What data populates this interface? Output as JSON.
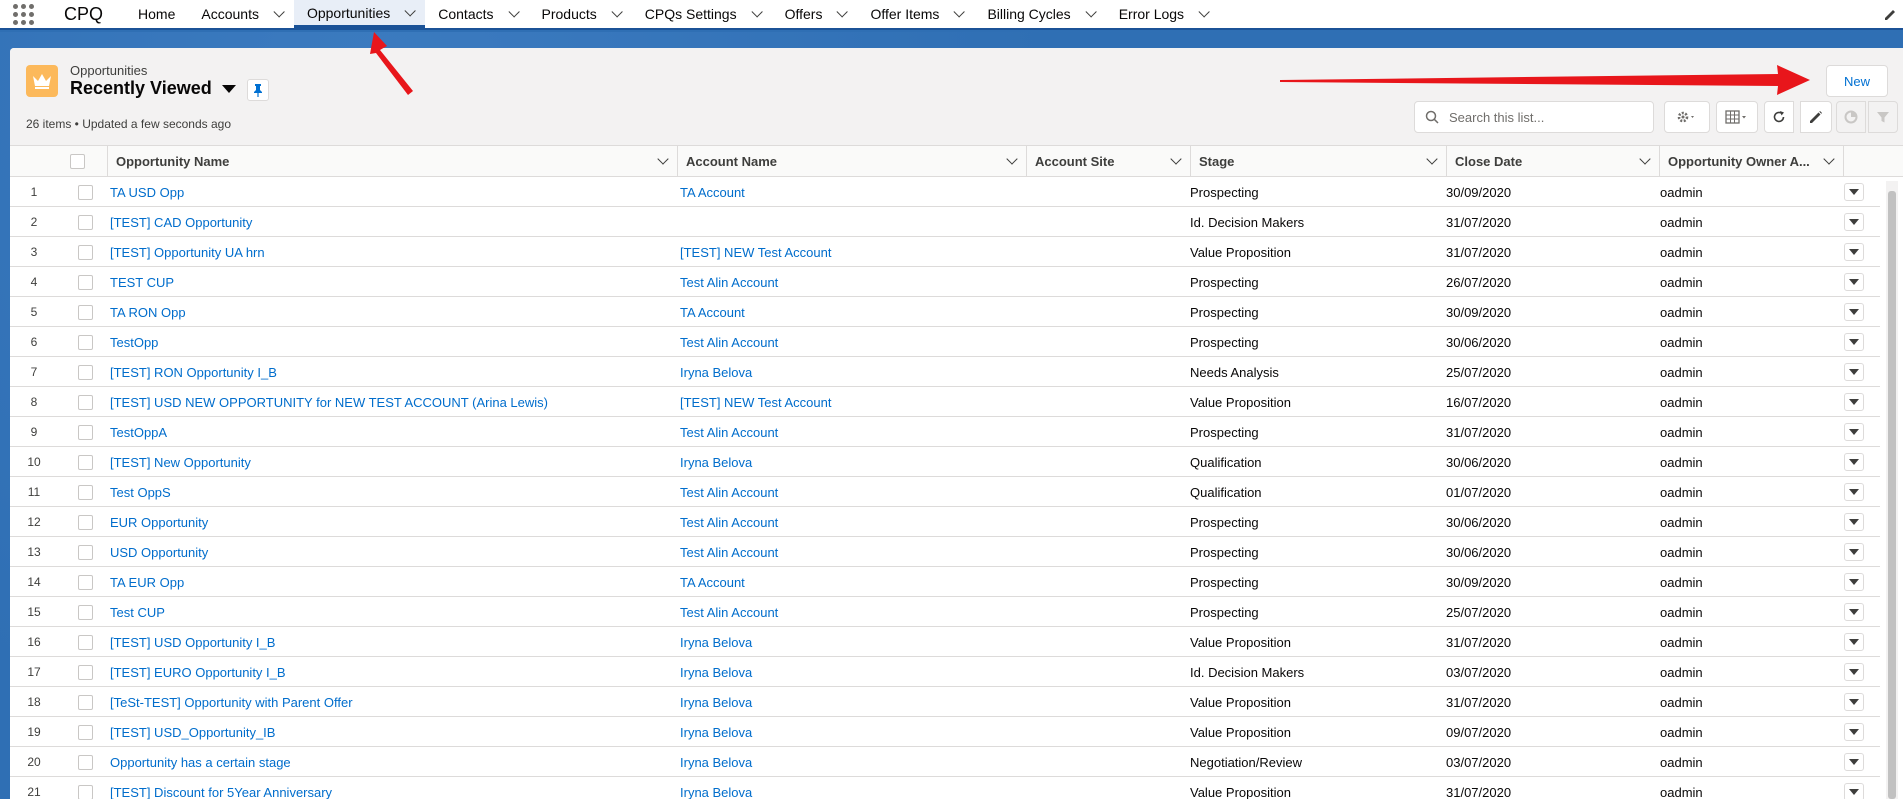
{
  "nav": {
    "app_name": "CPQ",
    "items": [
      {
        "label": "Home",
        "has_menu": false,
        "active": false
      },
      {
        "label": "Accounts",
        "has_menu": true,
        "active": false
      },
      {
        "label": "Opportunities",
        "has_menu": true,
        "active": true
      },
      {
        "label": "Contacts",
        "has_menu": true,
        "active": false
      },
      {
        "label": "Products",
        "has_menu": true,
        "active": false
      },
      {
        "label": "CPQs Settings",
        "has_menu": true,
        "active": false
      },
      {
        "label": "Offers",
        "has_menu": true,
        "active": false
      },
      {
        "label": "Offer Items",
        "has_menu": true,
        "active": false
      },
      {
        "label": "Billing Cycles",
        "has_menu": true,
        "active": false
      },
      {
        "label": "Error Logs",
        "has_menu": true,
        "active": false
      }
    ]
  },
  "header": {
    "object_label": "Opportunities",
    "list_view": "Recently Viewed",
    "meta": "26 items • Updated a few seconds ago",
    "new_label": "New",
    "search_placeholder": "Search this list..."
  },
  "table": {
    "columns": [
      "Opportunity Name",
      "Account Name",
      "Account Site",
      "Stage",
      "Close Date",
      "Opportunity Owner A..."
    ],
    "rows": [
      {
        "n": "1",
        "opp": "TA USD Opp",
        "acc": "TA Account",
        "site": "",
        "stage": "Prospecting",
        "date": "30/09/2020",
        "owner": "oadmin"
      },
      {
        "n": "2",
        "opp": "[TEST] CAD Opportunity",
        "acc": "",
        "site": "",
        "stage": "Id. Decision Makers",
        "date": "31/07/2020",
        "owner": "oadmin"
      },
      {
        "n": "3",
        "opp": "[TEST] Opportunity UA hrn",
        "acc": "[TEST] NEW Test Account",
        "site": "",
        "stage": "Value Proposition",
        "date": "31/07/2020",
        "owner": "oadmin"
      },
      {
        "n": "4",
        "opp": "TEST CUP",
        "acc": "Test Alin Account",
        "site": "",
        "stage": "Prospecting",
        "date": "26/07/2020",
        "owner": "oadmin"
      },
      {
        "n": "5",
        "opp": "TA RON Opp",
        "acc": "TA Account",
        "site": "",
        "stage": "Prospecting",
        "date": "30/09/2020",
        "owner": "oadmin"
      },
      {
        "n": "6",
        "opp": "TestOpp",
        "acc": "Test Alin Account",
        "site": "",
        "stage": "Prospecting",
        "date": "30/06/2020",
        "owner": "oadmin"
      },
      {
        "n": "7",
        "opp": "[TEST] RON Opportunity I_B",
        "acc": "Iryna Belova",
        "site": "",
        "stage": "Needs Analysis",
        "date": "25/07/2020",
        "owner": "oadmin"
      },
      {
        "n": "8",
        "opp": "[TEST] USD NEW OPPORTUNITY for NEW TEST ACCOUNT (Arina Lewis)",
        "acc": "[TEST] NEW Test Account",
        "site": "",
        "stage": "Value Proposition",
        "date": "16/07/2020",
        "owner": "oadmin"
      },
      {
        "n": "9",
        "opp": "TestOppA",
        "acc": "Test Alin Account",
        "site": "",
        "stage": "Prospecting",
        "date": "31/07/2020",
        "owner": "oadmin"
      },
      {
        "n": "10",
        "opp": "[TEST] New Opportunity",
        "acc": "Iryna Belova",
        "site": "",
        "stage": "Qualification",
        "date": "30/06/2020",
        "owner": "oadmin"
      },
      {
        "n": "11",
        "opp": "Test OppS",
        "acc": "Test Alin Account",
        "site": "",
        "stage": "Qualification",
        "date": "01/07/2020",
        "owner": "oadmin"
      },
      {
        "n": "12",
        "opp": "EUR Opportunity",
        "acc": "Test Alin Account",
        "site": "",
        "stage": "Prospecting",
        "date": "30/06/2020",
        "owner": "oadmin"
      },
      {
        "n": "13",
        "opp": "USD Opportunity",
        "acc": "Test Alin Account",
        "site": "",
        "stage": "Prospecting",
        "date": "30/06/2020",
        "owner": "oadmin"
      },
      {
        "n": "14",
        "opp": "TA EUR Opp",
        "acc": "TA Account",
        "site": "",
        "stage": "Prospecting",
        "date": "30/09/2020",
        "owner": "oadmin"
      },
      {
        "n": "15",
        "opp": "Test CUP",
        "acc": "Test Alin Account",
        "site": "",
        "stage": "Prospecting",
        "date": "25/07/2020",
        "owner": "oadmin"
      },
      {
        "n": "16",
        "opp": "[TEST] USD Opportunity I_B",
        "acc": "Iryna Belova",
        "site": "",
        "stage": "Value Proposition",
        "date": "31/07/2020",
        "owner": "oadmin"
      },
      {
        "n": "17",
        "opp": "[TEST] EURO Opportunity I_B",
        "acc": "Iryna Belova",
        "site": "",
        "stage": "Id. Decision Makers",
        "date": "03/07/2020",
        "owner": "oadmin"
      },
      {
        "n": "18",
        "opp": "[TeSt-TEST] Opportunity with Parent Offer",
        "acc": "Iryna Belova",
        "site": "",
        "stage": "Value Proposition",
        "date": "31/07/2020",
        "owner": "oadmin"
      },
      {
        "n": "19",
        "opp": "[TEST] USD_Opportunity_IB",
        "acc": "Iryna Belova",
        "site": "",
        "stage": "Value Proposition",
        "date": "09/07/2020",
        "owner": "oadmin"
      },
      {
        "n": "20",
        "opp": "Opportunity has a certain stage",
        "acc": "Iryna Belova",
        "site": "",
        "stage": "Negotiation/Review",
        "date": "03/07/2020",
        "owner": "oadmin"
      },
      {
        "n": "21",
        "opp": "[TEST] Discount for 5Year Anniversary",
        "acc": "Iryna Belova",
        "site": "",
        "stage": "Value Proposition",
        "date": "31/07/2020",
        "owner": "oadmin"
      }
    ]
  },
  "colors": {
    "brand_blue": "#2f6fb4",
    "link": "#006dcc",
    "object_icon": "#fcb95b",
    "annotation_arrow": "#e8161b"
  },
  "icons": [
    "app-launcher-icon",
    "chevron-down-icon",
    "crown-icon",
    "pin-icon",
    "search-icon",
    "gear-icon",
    "table-view-icon",
    "refresh-icon",
    "pencil-icon",
    "chart-icon",
    "filter-icon",
    "row-action-icon"
  ]
}
